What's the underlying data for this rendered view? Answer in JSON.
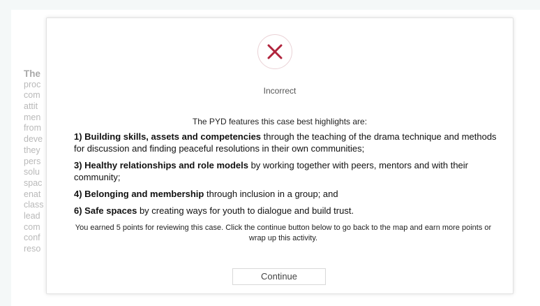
{
  "background_text": [
    "The",
    "proc",
    "com",
    "attit",
    "men",
    "from",
    "deve",
    "they",
    "pers",
    "solu",
    "spac",
    "enat",
    "class",
    "lead",
    "com",
    "conf",
    "reso"
  ],
  "modal": {
    "status_icon": "close-x-icon",
    "status_label": "Incorrect",
    "intro": "The PYD features this case best highlights are:",
    "features": [
      {
        "bold": "1) Building skills, assets and competencies",
        "rest": " through the teaching of the drama technique and methods for discussion and finding peaceful resolutions in their own communities;"
      },
      {
        "bold": "3) Healthy relationships and role models",
        "rest": " by working together with peers, mentors and with their community;"
      },
      {
        "bold": "4) Belonging and membership",
        "rest": " through inclusion in a group; and"
      },
      {
        "bold": "6) Safe spaces",
        "rest": " by creating ways for youth to dialogue and build trust."
      }
    ],
    "note": "You earned 5 points for reviewing this case. Click the continue button below to go back to the map and earn more points or wrap up this activity.",
    "continue_label": "Continue"
  },
  "colors": {
    "icon_x": "#b0243c",
    "icon_ring": "#ead2d6",
    "background": "#f4f8f8"
  }
}
